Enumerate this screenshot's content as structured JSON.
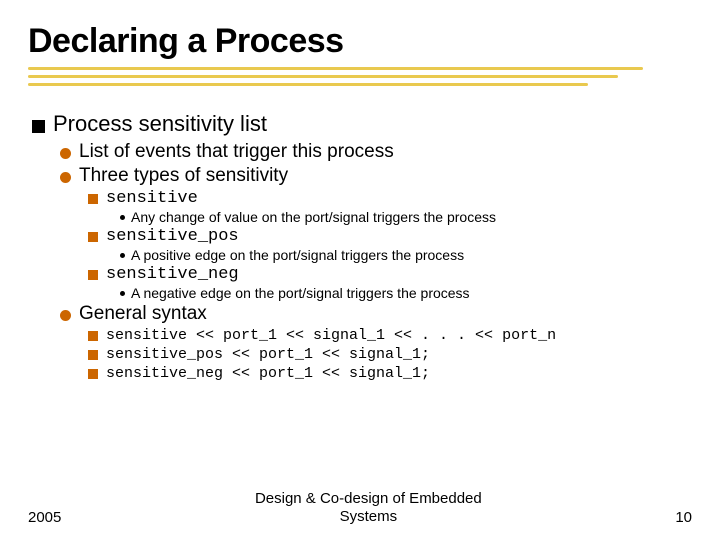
{
  "title": "Declaring a Process",
  "s1": {
    "heading": "Process sensitivity list"
  },
  "s2a": "List of events that trigger this process",
  "s2b": "Three types of sensitivity",
  "s3a": "sensitive",
  "s4a": "Any change of value on the port/signal triggers the process",
  "s3b": "sensitive_pos",
  "s4b": "A positive edge on the port/signal triggers the process",
  "s3c": "sensitive_neg",
  "s4c": "A negative edge on the port/signal triggers the process",
  "s2c": "General syntax",
  "code1": "sensitive << port_1 << signal_1 << . . . << port_n",
  "code2": "sensitive_pos << port_1 << signal_1;",
  "code3": "sensitive_neg << port_1 << signal_1;",
  "footer": {
    "left": "2005",
    "center_l1": "Design & Co-design of Embedded",
    "center_l2": "Systems",
    "right": "10"
  }
}
